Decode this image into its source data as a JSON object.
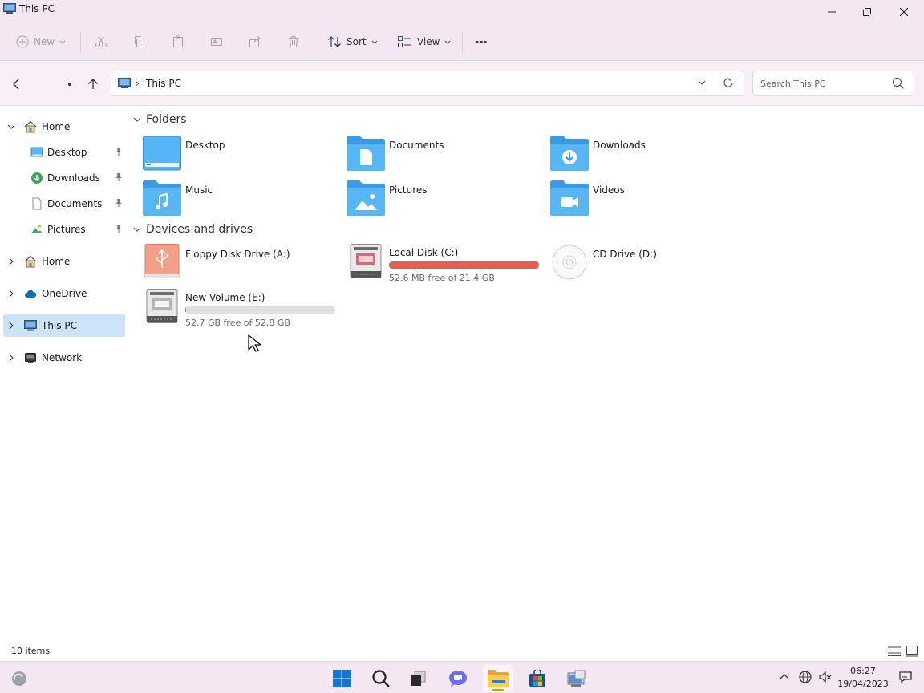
{
  "window": {
    "title": "This PC"
  },
  "toolbar": {
    "new_label": "New",
    "sort_label": "Sort",
    "view_label": "View",
    "more_label": "···"
  },
  "address": {
    "path": "This PC",
    "separator": "›"
  },
  "search": {
    "placeholder": "Search This PC"
  },
  "sidebar": {
    "items": [
      {
        "label": "Home"
      },
      {
        "label": "Desktop"
      },
      {
        "label": "Downloads"
      },
      {
        "label": "Documents"
      },
      {
        "label": "Pictures"
      },
      {
        "label": "Home"
      },
      {
        "label": "OneDrive"
      },
      {
        "label": "This PC"
      },
      {
        "label": "Network"
      }
    ]
  },
  "sections": {
    "folders": "Folders",
    "drives": "Devices and drives"
  },
  "folders": [
    {
      "name": "Desktop"
    },
    {
      "name": "Documents"
    },
    {
      "name": "Downloads"
    },
    {
      "name": "Music"
    },
    {
      "name": "Pictures"
    },
    {
      "name": "Videos"
    }
  ],
  "drives": [
    {
      "name": "Floppy Disk Drive (A:)"
    },
    {
      "name": "Local Disk (C:)",
      "free": "52.6 MB free of 21.4 GB",
      "used_fraction": 0.998,
      "bar_color": "#e0604f"
    },
    {
      "name": "CD Drive (D:)"
    },
    {
      "name": "New Volume (E:)",
      "free": "52.7 GB free of 52.8 GB",
      "used_fraction": 0.002,
      "bar_color": "#26a0da"
    }
  ],
  "status": {
    "count": "10 items"
  },
  "clock": {
    "time": "06:27",
    "date": "19/04/2023"
  }
}
